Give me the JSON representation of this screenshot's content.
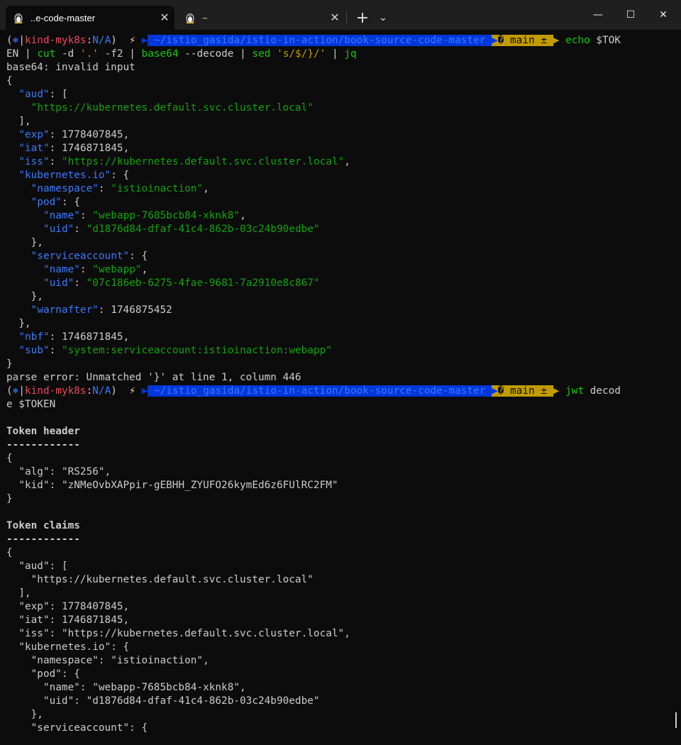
{
  "tabs": [
    {
      "label": "..e-code-master",
      "icon": "linux-penguin-icon"
    },
    {
      "label": "~",
      "icon": "linux-penguin-icon"
    }
  ],
  "controls": {
    "new_tab": "+",
    "dropdown": "⌄",
    "minimize": "—",
    "maximize": "☐",
    "close": "✕",
    "tab_close": "✕"
  },
  "prompt": {
    "open": "(",
    "k8s_icon": "⎈",
    "context": "kind-myk8s",
    "colon": ":",
    "namespace": "N/A",
    "close": ")",
    "bolt": "⚡",
    "path": "~/istio_gasida/istio-in-action/book-source-code-master",
    "branch": "� main ±"
  },
  "cmd1": {
    "echo": "echo",
    "var": " $TOK",
    "wrap": "EN",
    "pipe": " | ",
    "cut": "cut",
    "cut_args": " -d ",
    "cut_d": "'.'",
    "cut_f": " -f2",
    "base64": "base64",
    "base64_args": " --decode",
    "sed": "sed",
    "sed_arg": "'s/$/}/'",
    "jq": "jq"
  },
  "out1": {
    "error1": "base64: invalid input",
    "error2": "parse error: Unmatched '}' at line 1, column 446"
  },
  "cmd2": {
    "jwt": "jwt",
    "decode1": " decod",
    "decode2": "e $TOKEN"
  },
  "jwt_out": {
    "header_title": "Token header",
    "underline": "------------",
    "claims_title": "Token claims"
  },
  "claims": {
    "aud": "https://kubernetes.default.svc.cluster.local",
    "exp": "1778407845",
    "iat": "1746871845",
    "iss": "https://kubernetes.default.svc.cluster.local",
    "namespace": "istioinaction",
    "pod_name": "webapp-7685bcb84-xknk8",
    "pod_uid": "d1876d84-dfaf-41c4-862b-03c24b90edbe",
    "sa_name": "webapp",
    "sa_uid": "07c186eb-6275-4fae-9681-7a2910e8c867",
    "warnafter": "1746875452",
    "nbf": "1746871845",
    "sub": "system:serviceaccount:istioinaction:webapp"
  },
  "header": {
    "alg": "RS256",
    "kid": "zNMeOvbXAPpir-gEBHH_ZYUFO26kymEd6z6FUlRC2FM"
  },
  "keys": {
    "aud": "aud",
    "exp": "exp",
    "iat": "iat",
    "iss": "iss",
    "kio": "kubernetes.io",
    "namespace": "namespace",
    "pod": "pod",
    "name": "name",
    "uid": "uid",
    "serviceaccount": "serviceaccount",
    "warnafter": "warnafter",
    "nbf": "nbf",
    "sub": "sub",
    "alg": "alg",
    "kid": "kid"
  },
  "colors": {
    "background": "#0c0c0c",
    "key_blue": "#3b78ff",
    "string_green": "#13a10e",
    "prompt_red": "#e74856",
    "git_yellow": "#c19c00",
    "path_blue": "#0037da"
  }
}
